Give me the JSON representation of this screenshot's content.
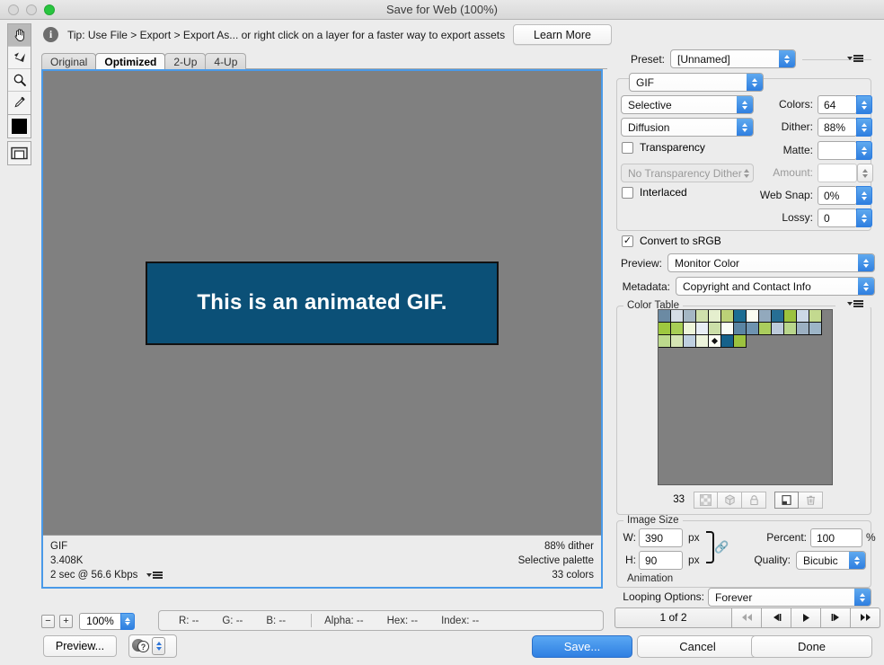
{
  "window": {
    "title": "Save for Web (100%)",
    "traffic": [
      "close",
      "minimize",
      "zoom"
    ]
  },
  "tip": {
    "text": "Tip: Use File > Export > Export As...  or right click on a layer for a faster way to export assets",
    "learn_more_label": "Learn More",
    "info_glyph": "i"
  },
  "tools": [
    {
      "name": "hand-tool",
      "glyph": "✋",
      "active": true
    },
    {
      "name": "slice-select-tool",
      "glyph": "✐",
      "active": false
    },
    {
      "name": "zoom-tool",
      "glyph": "🔍",
      "active": false
    },
    {
      "name": "eyedropper-tool",
      "glyph": "✒",
      "active": false
    }
  ],
  "foreground_color": "#000000",
  "tabs": [
    {
      "label": "Original",
      "selected": false
    },
    {
      "label": "Optimized",
      "selected": true
    },
    {
      "label": "2-Up",
      "selected": false
    },
    {
      "label": "4-Up",
      "selected": false
    }
  ],
  "preview": {
    "artwork_text": "This is an animated GIF.",
    "artwork_bg": "#0b5077",
    "canvas_bg": "#808080",
    "status": {
      "format": "GIF",
      "file_size": "3.408K",
      "download_time": "2 sec @ 56.6 Kbps",
      "dither": "88% dither",
      "palette": "Selective palette",
      "colors": "33 colors"
    }
  },
  "zoom_control": {
    "minus": "−",
    "plus": "+",
    "value": "100%"
  },
  "readout": {
    "r": "R: --",
    "g": "G: --",
    "b": "B: --",
    "alpha": "Alpha: --",
    "hex": "Hex: --",
    "index": "Index: --"
  },
  "bottom_buttons": {
    "preview": "Preview...",
    "save": "Save...",
    "cancel": "Cancel",
    "done": "Done"
  },
  "settings": {
    "preset_label": "Preset:",
    "preset_value": "[Unnamed]",
    "format_value": "GIF",
    "reduction_value": "Selective",
    "dither_algo_value": "Diffusion",
    "colors_label": "Colors:",
    "colors_value": "64",
    "dither_label": "Dither:",
    "dither_value": "88%",
    "transparency_label": "Transparency",
    "transparency_checked": false,
    "matte_label": "Matte:",
    "matte_value": "",
    "transparency_dither_value": "No Transparency Dither",
    "amount_label": "Amount:",
    "amount_value": "",
    "interlaced_label": "Interlaced",
    "interlaced_checked": false,
    "web_snap_label": "Web Snap:",
    "web_snap_value": "0%",
    "lossy_label": "Lossy:",
    "lossy_value": "0",
    "convert_srgb_label": "Convert to sRGB",
    "convert_srgb_checked": true,
    "preview_label": "Preview:",
    "preview_value": "Monitor Color",
    "metadata_label": "Metadata:",
    "metadata_value": "Copyright and Contact Info"
  },
  "color_table": {
    "title": "Color Table",
    "count": "33",
    "selected_index": 30,
    "swatches": [
      "#6b8aa3",
      "#d5dde5",
      "#a5b7c4",
      "#cfe0ac",
      "#e5efce",
      "#bcd177",
      "#1d6e93",
      "#fbfdf2",
      "#92a9bd",
      "#276e94",
      "#9cc23f",
      "#ccd8e6",
      "#c3d98f",
      "#9ec83f",
      "#a8cf55",
      "#eef6da",
      "#e8eef5",
      "#ccdfa8",
      "#fafdf6",
      "#5b85a3",
      "#6e93b0",
      "#aacd5d",
      "#bccada",
      "#b9d68c",
      "#9cb0c2",
      "#9db5c7",
      "#bcd98d",
      "#d5e5b4",
      "#bfd0e0",
      "#edf4dc",
      "#fafdf3",
      "#15618a",
      "#9cc23f"
    ],
    "buttons": [
      {
        "name": "transparency-swatch-button",
        "disabled": true
      },
      {
        "name": "web-shift-button",
        "disabled": true
      },
      {
        "name": "lock-color-button",
        "disabled": true
      },
      {
        "name": "new-color-button",
        "disabled": false
      },
      {
        "name": "delete-color-button",
        "disabled": true
      }
    ]
  },
  "image_size": {
    "title": "Image Size",
    "w_label": "W:",
    "w_value": "390",
    "w_unit": "px",
    "h_label": "H:",
    "h_value": "90",
    "h_unit": "px",
    "percent_label": "Percent:",
    "percent_value": "100",
    "percent_unit": "%",
    "quality_label": "Quality:",
    "quality_value": "Bicubic",
    "link_locked": true
  },
  "animation": {
    "title": "Animation",
    "looping_label": "Looping Options:",
    "looping_value": "Forever",
    "frame_counter": "1 of 2",
    "nav_buttons": [
      {
        "name": "first-frame-button",
        "glyph": "first",
        "disabled": true
      },
      {
        "name": "previous-frame-button",
        "glyph": "prev",
        "disabled": false
      },
      {
        "name": "play-button",
        "glyph": "play",
        "disabled": false
      },
      {
        "name": "next-frame-button",
        "glyph": "next",
        "disabled": false
      },
      {
        "name": "last-frame-button",
        "glyph": "last",
        "disabled": false
      }
    ]
  }
}
